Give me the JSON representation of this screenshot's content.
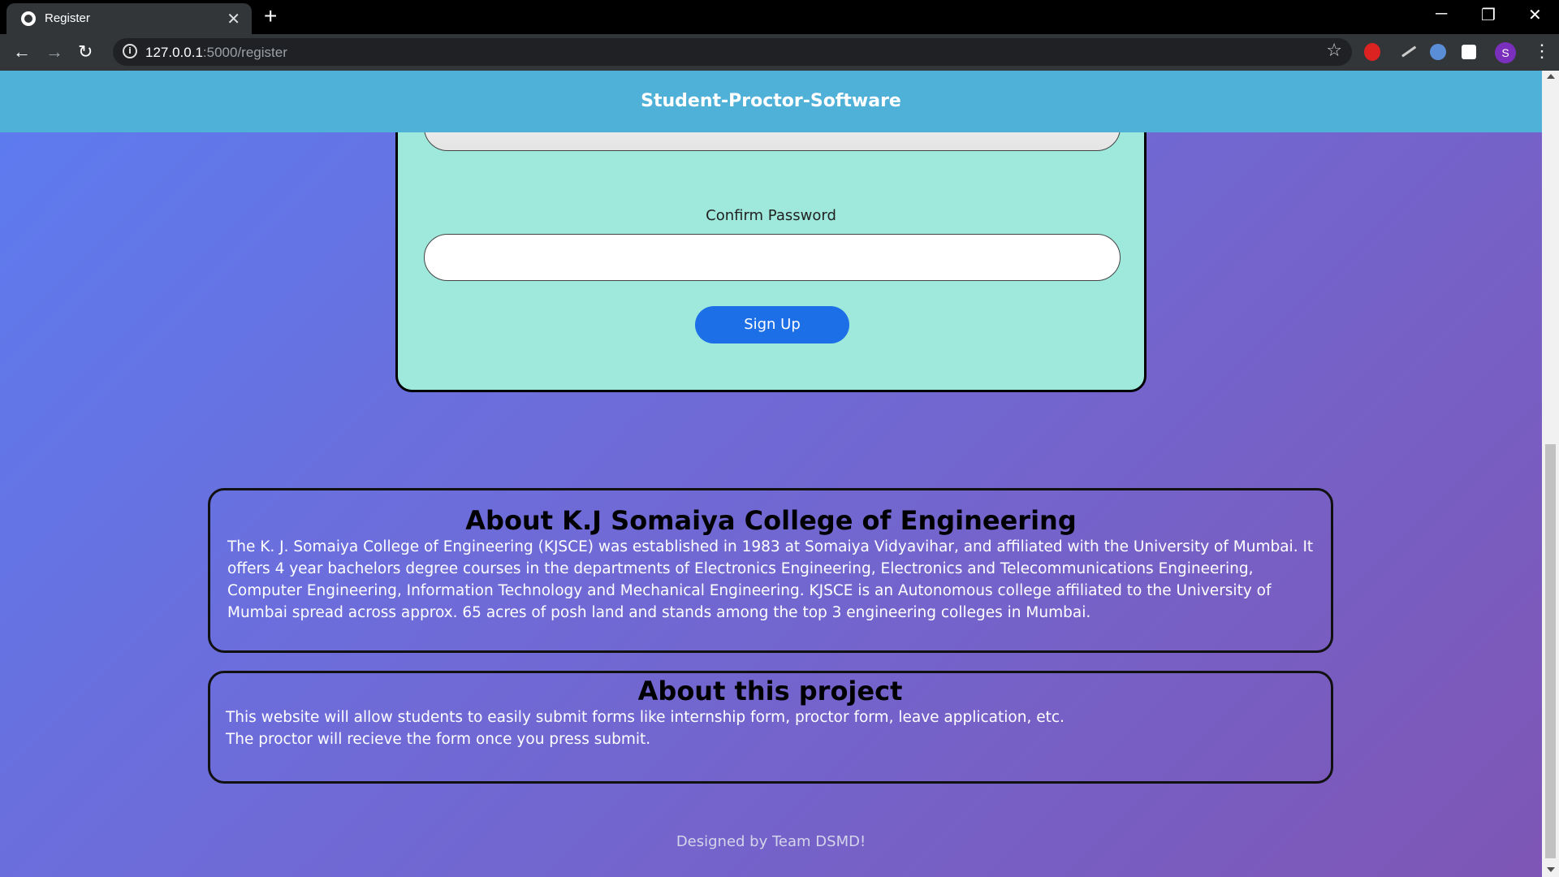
{
  "browser": {
    "tab_title": "Register",
    "tab_close": "✕",
    "new_tab": "+",
    "url_host": "127.0.0.1",
    "url_path": ":5000/register",
    "profile_initial": "S",
    "minimize": "─",
    "restore": "❐",
    "close_window": "✕",
    "back": "←",
    "forward": "→",
    "reload": "↻",
    "info": "i",
    "star": "☆",
    "menu": "⋮"
  },
  "header": {
    "brand": "Student-Proctor-Software"
  },
  "form": {
    "confirm_password_label": "Confirm Password",
    "confirm_password_value": "",
    "signup_label": "Sign Up"
  },
  "about_college": {
    "title": "About K.J Somaiya College of Engineering",
    "text": "The K. J. Somaiya College of Engineering (KJSCE) was established in 1983 at Somaiya Vidyavihar, and affiliated with the University of Mumbai. It offers 4 year bachelors degree courses in the departments of Electronics Engineering, Electronics and Telecommunications Engineering, Computer Engineering, Information Technology and Mechanical Engineering. KJSCE is an Autonomous college affiliated to the University of Mumbai spread across approx. 65 acres of posh land and stands among the top 3 engineering colleges in Mumbai."
  },
  "about_project": {
    "title": "About this project",
    "line1": "This website will allow students to easily submit forms like internship form, proctor form, leave application, etc.",
    "line2": "The proctor will recieve the form once you press submit."
  },
  "footer": {
    "text": "Designed by Team DSMD!"
  },
  "colors": {
    "header_bg": "#4fb0d8",
    "form_bg": "#9ee8dc",
    "button_bg": "#1c6fe6",
    "page_gradient_start": "#5c7cf0",
    "page_gradient_end": "#7e56b5"
  }
}
